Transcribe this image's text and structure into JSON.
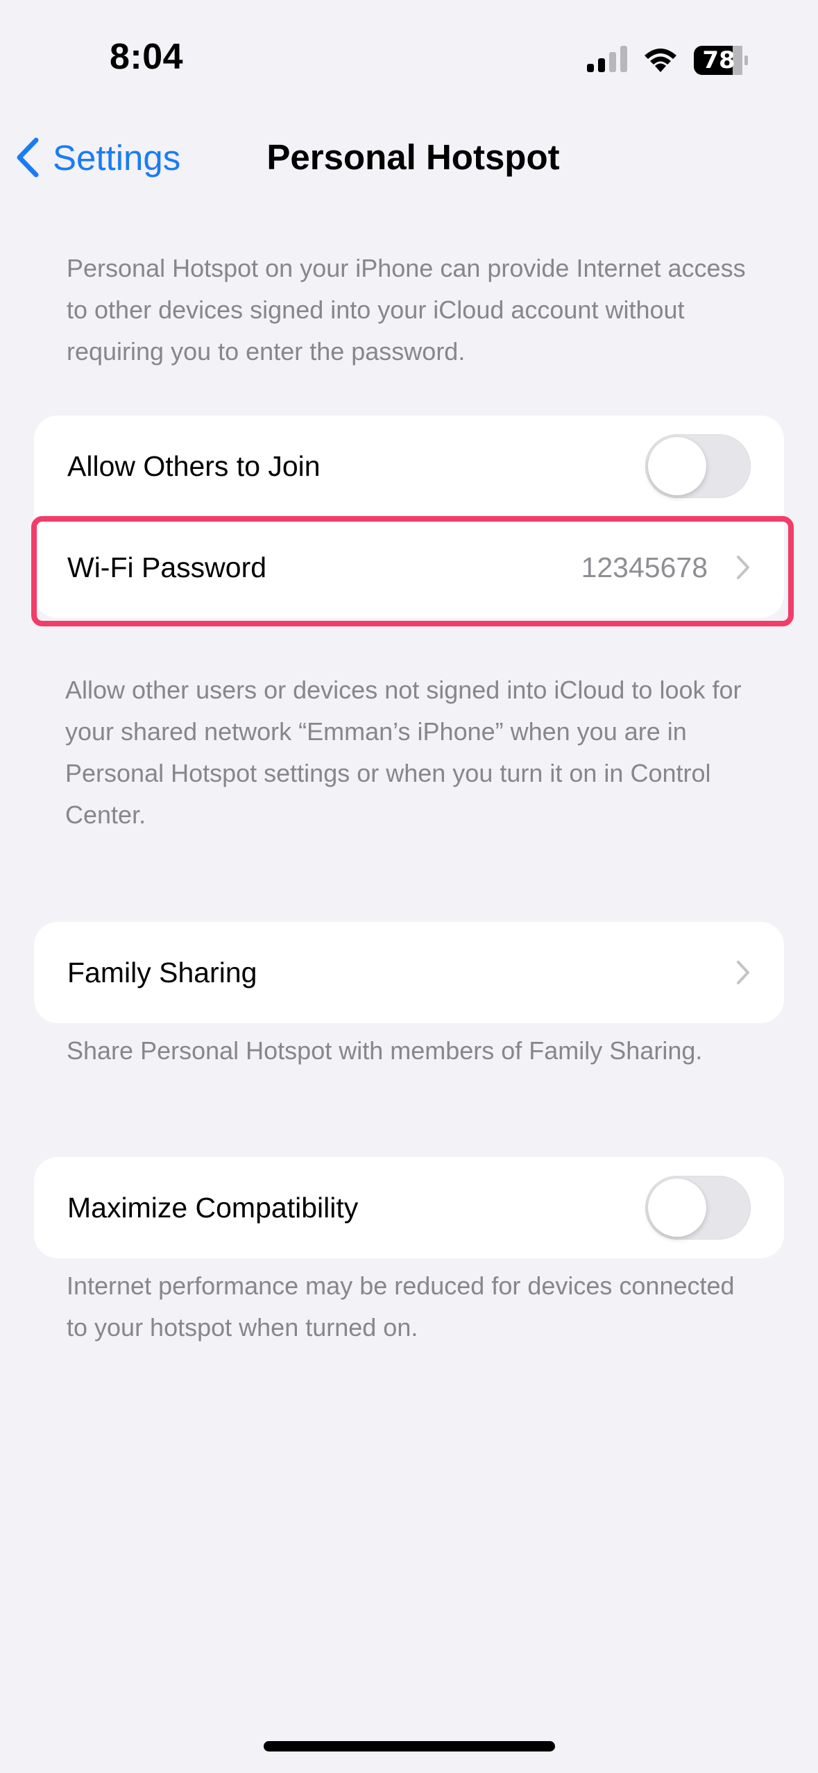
{
  "status_bar": {
    "time": "8:04",
    "battery": "78",
    "icons": [
      "signal-icon",
      "wifi-icon",
      "battery-icon"
    ]
  },
  "nav": {
    "back_label": "Settings",
    "title": "Personal Hotspot",
    "accent_color": "#1A7CF5"
  },
  "intro_note": "Personal Hotspot on your iPhone can provide Internet access to other devices signed into your iCloud account without requiring you to enter the password.",
  "hotspot_group": {
    "allow_others": {
      "label": "Allow Others to Join",
      "enabled": false
    },
    "wifi_password": {
      "label": "Wi-Fi Password",
      "value": "12345678"
    },
    "note": "Allow other users or devices not signed into iCloud to look for your shared network “Emman’s iPhone” when you are in Personal Hotspot settings or when you turn it on in Control Center."
  },
  "family_group": {
    "label": "Family Sharing",
    "note": "Share Personal Hotspot with members of Family Sharing."
  },
  "compat_group": {
    "label": "Maximize Compatibility",
    "enabled": false,
    "note": "Internet performance may be reduced for devices connected to your hotspot when turned on."
  },
  "highlight_color": "#F23D68"
}
